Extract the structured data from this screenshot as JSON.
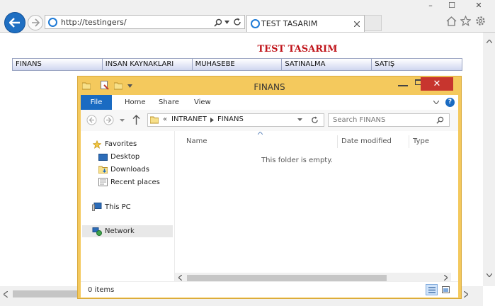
{
  "browser": {
    "address": "http://testingers/",
    "tab_title": "TEST TASARIM",
    "window_controls": {
      "minimize": "–",
      "maximize": "☐",
      "close": "✕"
    }
  },
  "page": {
    "title": "TEST TASARIM",
    "menu": [
      {
        "label": "FINANS"
      },
      {
        "label": "INSAN KAYNAKLARI"
      },
      {
        "label": "MUHASEBE"
      },
      {
        "label": "SATINALMA"
      },
      {
        "label": "SATIŞ"
      }
    ]
  },
  "explorer": {
    "title": "FINANS",
    "close_label": "✕",
    "ribbon_tabs": [
      "File",
      "Home",
      "Share",
      "View"
    ],
    "breadcrumb": {
      "prefix": "«",
      "items": [
        "INTRANET",
        "FINANS"
      ]
    },
    "search_placeholder": "Search FINANS",
    "nav_pane": {
      "favorites": "Favorites",
      "favorite_items": [
        "Desktop",
        "Downloads",
        "Recent places"
      ],
      "this_pc": "This PC",
      "network": "Network"
    },
    "columns": [
      "Name",
      "Date modified",
      "Type"
    ],
    "empty_message": "This folder is empty.",
    "status": "0 items"
  },
  "colors": {
    "explorer_frame": "#f4c95d",
    "file_tab": "#1a6bc2",
    "close_button": "#c7352e",
    "page_title": "#c0141a",
    "back_button": "#1f6fc2"
  }
}
